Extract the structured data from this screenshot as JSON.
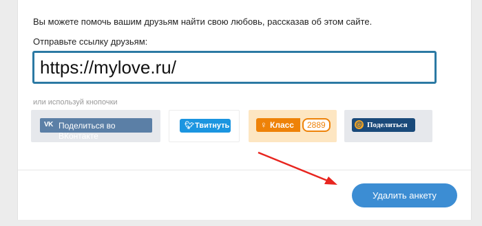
{
  "share": {
    "intro": "Вы можете помочь вашим друзьям найти свою любовь, рассказав об этом сайте.",
    "send_link_label": "Отправьте ссылку друзьям:",
    "url": "https://mylove.ru/",
    "or_buttons_label": "или используй кнопочки"
  },
  "buttons": {
    "vk": {
      "logo": "VK",
      "line1": "Поделиться во",
      "line2": "ВКонтакте",
      "color": "#5b7fa6"
    },
    "twitter": {
      "label": "Твитнуть",
      "color": "#1b95e0"
    },
    "ok": {
      "label": "Класс",
      "count": "2889",
      "color": "#ee8208"
    },
    "mailru": {
      "label": "Поделиться",
      "color": "#1a4a7a"
    }
  },
  "actions": {
    "delete_label": "Удалить анкету",
    "delete_color": "#3c8dd3"
  },
  "annotation": {
    "arrow_color": "#e8251f"
  }
}
